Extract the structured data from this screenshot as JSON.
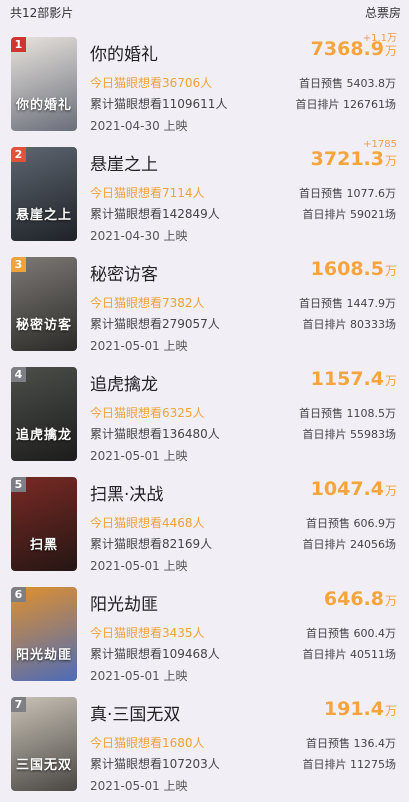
{
  "header": {
    "count_label": "共12部影片",
    "total_label": "总票房"
  },
  "movies": [
    {
      "rank": "1",
      "title": "你的婚礼",
      "increment": "+1.1万",
      "box": "7368.9",
      "unit": "万",
      "today": "今日猫眼想看36706人",
      "cumulative": "累计猫眼想看1109611人",
      "presale": "首日预售 5403.8万",
      "schedule": "首日排片 126761场",
      "date": "2021-04-30 上映",
      "poster_text": "你的婚礼",
      "poster_colors": [
        "#e9e4de",
        "#6a6e7a"
      ],
      "rank_color": "#d2352f"
    },
    {
      "rank": "2",
      "title": "悬崖之上",
      "increment": "+1785",
      "box": "3721.3",
      "unit": "万",
      "today": "今日猫眼想看7114人",
      "cumulative": "累计猫眼想看142849人",
      "presale": "首日预售 1077.6万",
      "schedule": "首日排片 59021场",
      "date": "2021-04-30 上映",
      "poster_text": "悬崖之上",
      "poster_colors": [
        "#5f6670",
        "#1e2228"
      ],
      "rank_color": "#e2523a"
    },
    {
      "rank": "3",
      "title": "秘密访客",
      "increment": "",
      "box": "1608.5",
      "unit": "万",
      "today": "今日猫眼想看7382人",
      "cumulative": "累计猫眼想看279057人",
      "presale": "首日预售 1447.9万",
      "schedule": "首日排片 80333场",
      "date": "2021-05-01 上映",
      "poster_text": "秘密访客",
      "poster_colors": [
        "#7d7a76",
        "#2c2a28"
      ],
      "rank_color": "#f0a23c"
    },
    {
      "rank": "4",
      "title": "追虎擒龙",
      "increment": "",
      "box": "1157.4",
      "unit": "万",
      "today": "今日猫眼想看6325人",
      "cumulative": "累计猫眼想看136480人",
      "presale": "首日预售 1108.5万",
      "schedule": "首日排片 55983场",
      "date": "2021-05-01 上映",
      "poster_text": "追虎擒龙",
      "poster_colors": [
        "#4d4f4b",
        "#1c1d1b"
      ],
      "rank_color": "#7d7f85"
    },
    {
      "rank": "5",
      "title": "扫黑·决战",
      "increment": "",
      "box": "1047.4",
      "unit": "万",
      "today": "今日猫眼想看4468人",
      "cumulative": "累计猫眼想看82169人",
      "presale": "首日预售 606.9万",
      "schedule": "首日排片 24056场",
      "date": "2021-05-01 上映",
      "poster_text": "扫黑",
      "poster_colors": [
        "#7a2a24",
        "#241614"
      ],
      "rank_color": "#7d7f85"
    },
    {
      "rank": "6",
      "title": "阳光劫匪",
      "increment": "",
      "box": "646.8",
      "unit": "万",
      "today": "今日猫眼想看3435人",
      "cumulative": "累计猫眼想看109468人",
      "presale": "首日预售 600.4万",
      "schedule": "首日排片 40511场",
      "date": "2021-05-01 上映",
      "poster_text": "阳光劫匪",
      "poster_colors": [
        "#e0902e",
        "#4d6cb8"
      ],
      "rank_color": "#7d7f85"
    },
    {
      "rank": "7",
      "title": "真·三国无双",
      "increment": "",
      "box": "191.4",
      "unit": "万",
      "today": "今日猫眼想看1680人",
      "cumulative": "累计猫眼想看107203人",
      "presale": "首日预售 136.4万",
      "schedule": "首日排片 11275场",
      "date": "2021-05-01 上映",
      "poster_text": "三国无双",
      "poster_colors": [
        "#c9c2b6",
        "#4a4744"
      ],
      "rank_color": "#7d7f85"
    }
  ]
}
